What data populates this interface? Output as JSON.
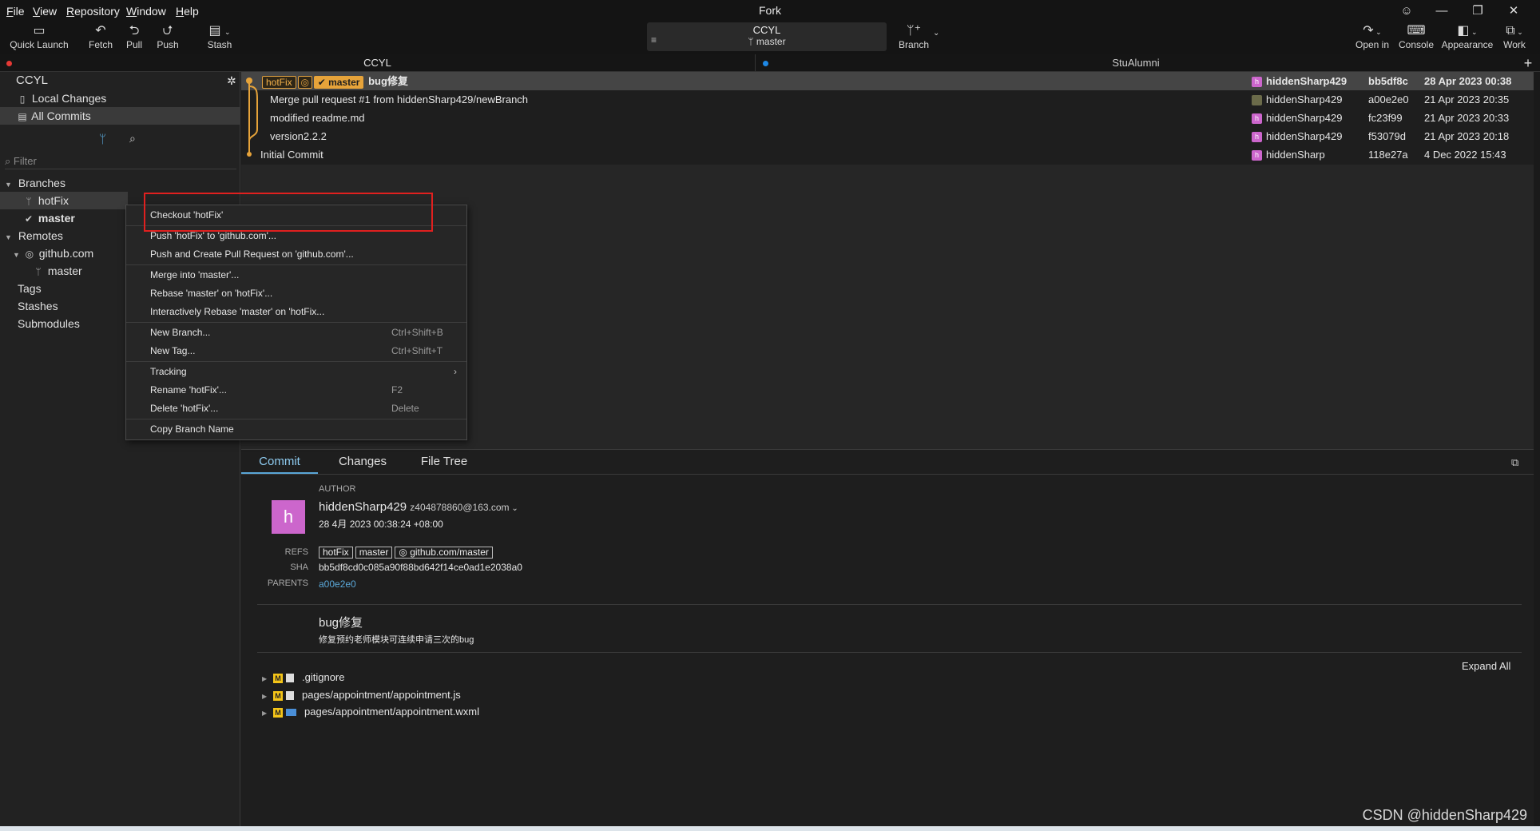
{
  "window": {
    "title": "Fork"
  },
  "menu": [
    "File",
    "View",
    "Repository",
    "Window",
    "Help"
  ],
  "toolbar": {
    "quick_launch": "Quick Launch",
    "fetch": "Fetch",
    "pull": "Pull",
    "push": "Push",
    "stash": "Stash",
    "repo_name": "CCYL",
    "repo_branch": "master",
    "branch": "Branch",
    "open_in": "Open in",
    "console": "Console",
    "appearance": "Appearance",
    "work": "Work"
  },
  "tabs": [
    {
      "label": "CCYL",
      "dot_color": "#e53935"
    },
    {
      "label": "StuAlumni",
      "dot_color": "#1e88e5"
    }
  ],
  "sidebar": {
    "repo": "CCYL",
    "local_changes": "Local Changes",
    "all_commits": "All Commits",
    "filter_placeholder": "Filter",
    "branches": "Branches",
    "branch_hotfix": "hotFix",
    "branch_master": "master",
    "remotes": "Remotes",
    "remote_name": "github.com",
    "remote_branch": "master",
    "tags": "Tags",
    "stashes": "Stashes",
    "submodules": "Submodules"
  },
  "commits": [
    {
      "refs": [
        "hotFix",
        "master"
      ],
      "message": "bug修复",
      "author": "hiddenSharp429",
      "sha": "bb5df8c",
      "date": "28 Apr 2023 00:38"
    },
    {
      "refs": [],
      "message": "Merge pull request #1 from hiddenSharp429/newBranch",
      "author": "hiddenSharp429",
      "sha": "a00e2e0",
      "date": "21 Apr 2023 20:35"
    },
    {
      "refs": [],
      "message": "modified readme.md",
      "author": "hiddenSharp429",
      "sha": "fc23f99",
      "date": "21 Apr 2023 20:33"
    },
    {
      "refs": [],
      "message": "version2.2.2",
      "author": "hiddenSharp429",
      "sha": "f53079d",
      "date": "21 Apr 2023 20:18"
    },
    {
      "refs": [],
      "message": "Initial Commit",
      "author": "hiddenSharp",
      "sha": "118e27a",
      "date": "4 Dec 2022 15:43"
    }
  ],
  "context_menu": {
    "checkout": "Checkout 'hotFix'",
    "push": "Push 'hotFix' to 'github.com'...",
    "push_pr": "Push and Create Pull Request on 'github.com'...",
    "merge": "Merge into 'master'...",
    "rebase": "Rebase 'master' on 'hotFix'...",
    "irebase": "Interactively Rebase 'master' on 'hotFix...",
    "new_branch": "New Branch...",
    "new_branch_sc": "Ctrl+Shift+B",
    "new_tag": "New Tag...",
    "new_tag_sc": "Ctrl+Shift+T",
    "tracking": "Tracking",
    "rename": "Rename 'hotFix'...",
    "rename_sc": "F2",
    "delete": "Delete 'hotFix'...",
    "delete_sc": "Delete",
    "copy_name": "Copy Branch Name"
  },
  "details": {
    "tabs": [
      "Commit",
      "Changes",
      "File Tree"
    ],
    "author_label": "AUTHOR",
    "avatar_letter": "h",
    "author_name": "hiddenSharp429",
    "author_email": "z404878860@163.com",
    "author_date": "28 4月 2023 00:38:24 +08:00",
    "refs_label": "REFS",
    "refs": [
      "hotFix",
      "master",
      "github.com/master"
    ],
    "sha_label": "SHA",
    "sha": "bb5df8cd0c085a90f88bd642f14ce0ad1e2038a0",
    "parents_label": "PARENTS",
    "parent": "a00e2e0",
    "subject": "bug修复",
    "body": "修复预约老师模块可连续申请三次的bug",
    "expand_all": "Expand All",
    "files": [
      ".gitignore",
      "pages/appointment/appointment.js",
      "pages/appointment/appointment.wxml"
    ]
  },
  "watermark": "CSDN @hiddenSharp429",
  "colors": {
    "accent": "#e6a33a",
    "highlight": "#e0201f",
    "avatar": "#cc66cc",
    "link": "#5aa7d8"
  }
}
